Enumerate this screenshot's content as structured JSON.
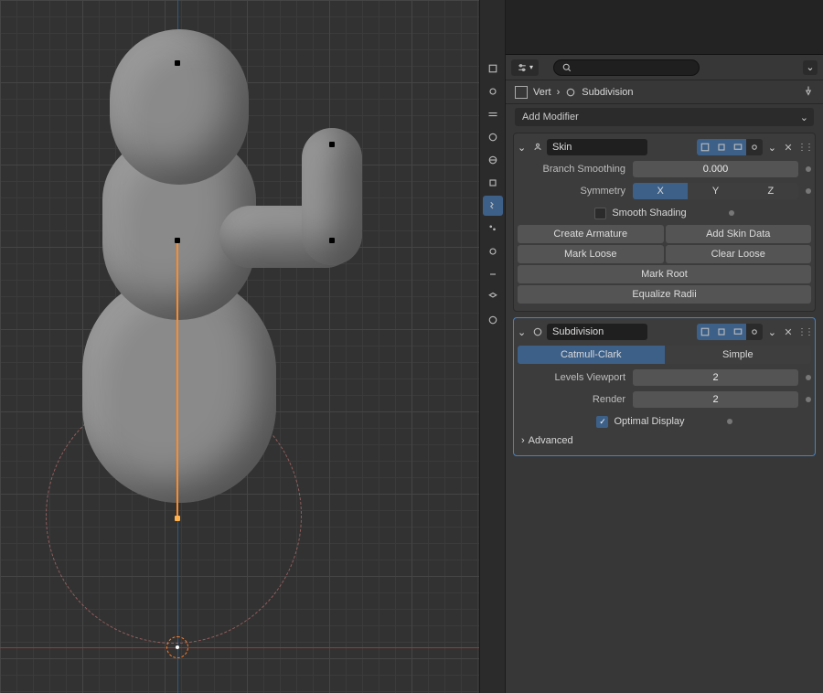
{
  "breadcrumb": {
    "item": "Vert",
    "mod": "Subdivision"
  },
  "search": {
    "placeholder": ""
  },
  "add_modifier_label": "Add Modifier",
  "tabs": [
    "render",
    "output",
    "view",
    "scene",
    "world",
    "coll",
    "object",
    "modifier",
    "particle",
    "physics",
    "constraint",
    "data",
    "material",
    "texture"
  ],
  "skin": {
    "name": "Skin",
    "branch_smoothing_label": "Branch Smoothing",
    "branch_smoothing": "0.000",
    "symmetry_label": "Symmetry",
    "symmetry": {
      "x": "X",
      "y": "Y",
      "z": "Z",
      "active": "x"
    },
    "smooth_shading_label": "Smooth Shading",
    "buttons": {
      "create_armature": "Create Armature",
      "add_skin_data": "Add Skin Data",
      "mark_loose": "Mark Loose",
      "clear_loose": "Clear Loose",
      "mark_root": "Mark Root",
      "equalize_radii": "Equalize Radii"
    }
  },
  "subsurf": {
    "name": "Subdivision",
    "mode": {
      "catmull": "Catmull-Clark",
      "simple": "Simple",
      "active": "catmull"
    },
    "viewport_label": "Levels Viewport",
    "viewport": "2",
    "render_label": "Render",
    "render": "2",
    "optimal_display_label": "Optimal Display",
    "advanced_label": "Advanced"
  }
}
